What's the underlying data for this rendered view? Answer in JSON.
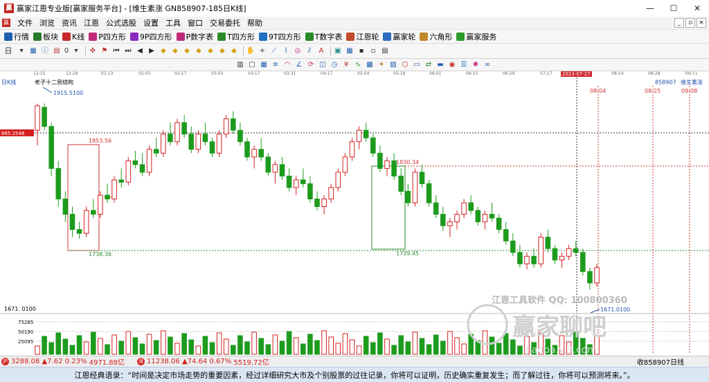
{
  "window": {
    "title": "赢家江恩专业版[赢家服务平台] - [维生素涨  GN858907-185日K线]",
    "app_badge": "赢",
    "controls": {
      "minimize": "—",
      "maximize": "☐",
      "close": "✕"
    }
  },
  "menubar": {
    "logo": "赢",
    "items": [
      "文件",
      "浏览",
      "资讯",
      "江恩",
      "公式选股",
      "设置",
      "工具",
      "窗口",
      "交易委托",
      "帮助"
    ],
    "mdi": [
      "_",
      "▫",
      "×"
    ]
  },
  "toolbar1": {
    "items": [
      {
        "label": "行情",
        "icon_name": "grid-icon",
        "color": "#1f5fb0"
      },
      {
        "label": "板块",
        "icon_name": "blocks-icon",
        "color": "#2a7a2a"
      },
      {
        "label": "K线",
        "icon_name": "kline-icon",
        "color": "#c62828"
      },
      {
        "label": "P四方形",
        "icon_name": "p-square-icon",
        "color": "#c02a7a"
      },
      {
        "label": "9P四方形",
        "icon_name": "9p-square-icon",
        "color": "#8a2ac0"
      },
      {
        "label": "P数字表",
        "icon_name": "p-table-icon",
        "color": "#c02a7a"
      },
      {
        "label": "T四方形",
        "icon_name": "t-square-icon",
        "color": "#2a8a2a"
      },
      {
        "label": "9T四方形",
        "icon_name": "9t-square-icon",
        "color": "#1f6fc0"
      },
      {
        "label": "T数字表",
        "icon_name": "t-table-icon",
        "color": "#2a8a2a"
      },
      {
        "label": "江恩轮",
        "icon_name": "gann-wheel-icon",
        "color": "#c04a2a"
      },
      {
        "label": "赢家轮",
        "icon_name": "winner-wheel-icon",
        "color": "#2a6ac0"
      },
      {
        "label": "六角形",
        "icon_name": "hexagon-icon",
        "color": "#c0882a"
      },
      {
        "label": "赢家服务",
        "icon_name": "dollar-icon",
        "color": "#2a9a2a"
      }
    ]
  },
  "toolbar2": {
    "period": "日",
    "zero": "0"
  },
  "date_axis": {
    "ticks": [
      "12-15",
      "12-29",
      "01-13",
      "02-03",
      "02-17",
      "03-03",
      "03-17",
      "03-31",
      "04-17",
      "05-04",
      "05-18",
      "06-01",
      "06-15",
      "06-29",
      "07-17",
      "08-14",
      "08-28",
      "09-11"
    ],
    "highlight": "2023-07-27"
  },
  "chart": {
    "period_label": "日K线",
    "title_label": "老子十二宫结构",
    "code": "858907",
    "name": "维生素涨",
    "price_marker": "865.2548",
    "high_label": "1915.5100",
    "low_label": "1671.0100",
    "left_low": "1671. 0100",
    "box1_top": "1853.56",
    "box1_bottom": "1738.36",
    "box2_top": "1830.34",
    "box2_bottom": "1739.45",
    "future_dates": [
      {
        "label": "08-04",
        "color": "#d23030"
      },
      {
        "label": "08-25",
        "color": "#d23030"
      },
      {
        "label": "09-08",
        "color": "#d23030"
      }
    ],
    "vol_ticks": [
      "75285",
      "50190",
      "25095"
    ],
    "watermark_1": "江恩工具软件  QQ: 100800360",
    "watermark_2": "赢家聊吧",
    "watermark_3": "jiaoba.v.3.com"
  },
  "chart_data": {
    "type": "candlestick",
    "title": "老子十二宫结构",
    "ylim": [
      1650,
      1940
    ],
    "candles": [
      [
        1880,
        1915,
        1860,
        1912
      ],
      [
        1910,
        1915,
        1880,
        1885
      ],
      [
        1885,
        1890,
        1820,
        1830
      ],
      [
        1830,
        1840,
        1780,
        1790
      ],
      [
        1790,
        1800,
        1760,
        1770
      ],
      [
        1770,
        1780,
        1740,
        1750
      ],
      [
        1750,
        1760,
        1738,
        1745
      ],
      [
        1745,
        1780,
        1740,
        1775
      ],
      [
        1775,
        1790,
        1765,
        1770
      ],
      [
        1770,
        1800,
        1765,
        1795
      ],
      [
        1795,
        1810,
        1785,
        1790
      ],
      [
        1790,
        1820,
        1785,
        1815
      ],
      [
        1815,
        1830,
        1805,
        1812
      ],
      [
        1812,
        1845,
        1808,
        1840
      ],
      [
        1840,
        1853,
        1830,
        1835
      ],
      [
        1835,
        1850,
        1820,
        1825
      ],
      [
        1825,
        1860,
        1820,
        1855
      ],
      [
        1855,
        1870,
        1845,
        1850
      ],
      [
        1850,
        1880,
        1845,
        1875
      ],
      [
        1875,
        1890,
        1860,
        1865
      ],
      [
        1865,
        1895,
        1860,
        1890
      ],
      [
        1890,
        1900,
        1870,
        1875
      ],
      [
        1875,
        1885,
        1850,
        1855
      ],
      [
        1855,
        1880,
        1850,
        1875
      ],
      [
        1875,
        1890,
        1860,
        1865
      ],
      [
        1865,
        1870,
        1845,
        1850
      ],
      [
        1850,
        1880,
        1845,
        1875
      ],
      [
        1875,
        1900,
        1870,
        1895
      ],
      [
        1895,
        1905,
        1875,
        1880
      ],
      [
        1880,
        1890,
        1860,
        1865
      ],
      [
        1865,
        1870,
        1840,
        1845
      ],
      [
        1845,
        1860,
        1830,
        1855
      ],
      [
        1855,
        1870,
        1840,
        1845
      ],
      [
        1845,
        1850,
        1820,
        1825
      ],
      [
        1825,
        1840,
        1810,
        1835
      ],
      [
        1835,
        1845,
        1815,
        1820
      ],
      [
        1820,
        1830,
        1800,
        1805
      ],
      [
        1805,
        1820,
        1795,
        1815
      ],
      [
        1815,
        1830,
        1805,
        1810
      ],
      [
        1810,
        1820,
        1785,
        1790
      ],
      [
        1790,
        1800,
        1775,
        1780
      ],
      [
        1780,
        1795,
        1770,
        1790
      ],
      [
        1790,
        1810,
        1785,
        1805
      ],
      [
        1805,
        1830,
        1800,
        1825
      ],
      [
        1825,
        1850,
        1820,
        1845
      ],
      [
        1845,
        1870,
        1840,
        1865
      ],
      [
        1865,
        1885,
        1855,
        1880
      ],
      [
        1880,
        1890,
        1865,
        1870
      ],
      [
        1870,
        1875,
        1845,
        1850
      ],
      [
        1850,
        1860,
        1825,
        1830
      ],
      [
        1830,
        1845,
        1820,
        1840
      ],
      [
        1840,
        1850,
        1815,
        1820
      ],
      [
        1820,
        1830,
        1795,
        1800
      ],
      [
        1800,
        1810,
        1780,
        1785
      ],
      [
        1785,
        1830,
        1780,
        1825
      ],
      [
        1825,
        1835,
        1805,
        1810
      ],
      [
        1810,
        1815,
        1780,
        1785
      ],
      [
        1785,
        1795,
        1765,
        1770
      ],
      [
        1770,
        1780,
        1748,
        1755
      ],
      [
        1755,
        1765,
        1740,
        1760
      ],
      [
        1760,
        1775,
        1750,
        1770
      ],
      [
        1770,
        1790,
        1765,
        1785
      ],
      [
        1785,
        1795,
        1770,
        1775
      ],
      [
        1775,
        1780,
        1755,
        1760
      ],
      [
        1760,
        1775,
        1750,
        1770
      ],
      [
        1770,
        1785,
        1760,
        1765
      ],
      [
        1765,
        1770,
        1745,
        1750
      ],
      [
        1750,
        1760,
        1730,
        1735
      ],
      [
        1735,
        1745,
        1715,
        1720
      ],
      [
        1720,
        1730,
        1700,
        1705
      ],
      [
        1705,
        1720,
        1698,
        1715
      ],
      [
        1715,
        1725,
        1700,
        1705
      ],
      [
        1705,
        1745,
        1700,
        1740
      ],
      [
        1740,
        1750,
        1720,
        1725
      ],
      [
        1725,
        1730,
        1705,
        1710
      ],
      [
        1710,
        1720,
        1700,
        1715
      ],
      [
        1715,
        1730,
        1710,
        1725
      ],
      [
        1725,
        1735,
        1715,
        1720
      ],
      [
        1720,
        1725,
        1690,
        1695
      ],
      [
        1695,
        1700,
        1671,
        1680
      ],
      [
        1680,
        1705,
        1675,
        1700
      ]
    ]
  },
  "statusbar": {
    "sh_icon": "沪",
    "sh_value": "3288.08",
    "sh_change": "▲7.62",
    "sh_pct": "0.23%",
    "sh_amount": "4971.88亿",
    "sz_icon": "深",
    "sz_value": "11238.06",
    "sz_change": "▲74.64",
    "sz_pct": "0.67%",
    "sz_amount": "5519.72亿",
    "right": "收858907日线"
  },
  "quote": "江恩经典语录：“时间是决定市场走势的重要因素，经过详细研究大市及个别股票的过往记录，你将可以证明，历史确实重复发生；而了解过往，你将可以预测将来。”。"
}
